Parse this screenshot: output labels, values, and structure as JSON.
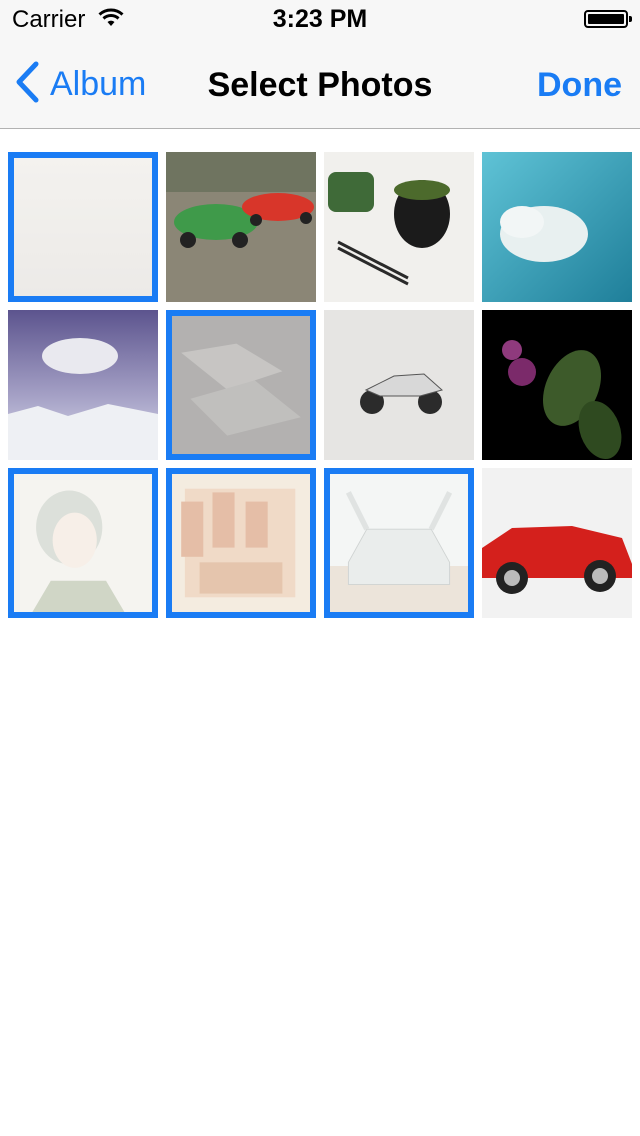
{
  "status_bar": {
    "carrier": "Carrier",
    "time": "3:23 PM"
  },
  "nav": {
    "back_label": "Album",
    "title": "Select Photos",
    "done_label": "Done"
  },
  "colors": {
    "accent": "#1a7cf4",
    "nav_background": "#f7f7f7"
  },
  "photos": [
    {
      "name": "fog-landscape",
      "selected": true
    },
    {
      "name": "green-and-red-porsches",
      "selected": false
    },
    {
      "name": "matcha-tea-and-chopsticks",
      "selected": false
    },
    {
      "name": "polar-bear-underwater",
      "selected": false
    },
    {
      "name": "floating-polar-bear",
      "selected": false
    },
    {
      "name": "paper-sculpture",
      "selected": true
    },
    {
      "name": "vespa-scooter",
      "selected": false
    },
    {
      "name": "botanical-flowers",
      "selected": false
    },
    {
      "name": "girl-portrait",
      "selected": true
    },
    {
      "name": "fight-club-poster",
      "selected": true
    },
    {
      "name": "gullwing-mercedes",
      "selected": true
    },
    {
      "name": "red-roadster",
      "selected": false
    }
  ]
}
